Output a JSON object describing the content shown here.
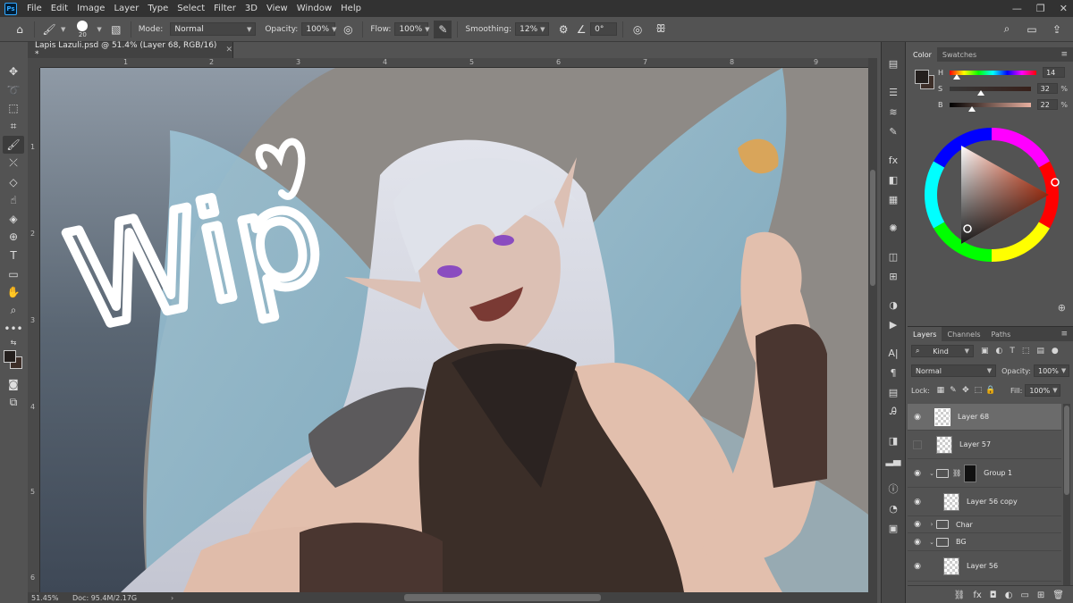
{
  "app": {
    "logo": "Ps"
  },
  "menu": [
    "File",
    "Edit",
    "Image",
    "Layer",
    "Type",
    "Select",
    "Filter",
    "3D",
    "View",
    "Window",
    "Help"
  ],
  "window_controls": {
    "minimize": "—",
    "restore": "❐",
    "close": "✕"
  },
  "options": {
    "brush_size": "20",
    "mode_label": "Mode:",
    "mode_value": "Normal",
    "opacity_label": "Opacity:",
    "opacity_value": "100%",
    "flow_label": "Flow:",
    "flow_value": "100%",
    "smoothing_label": "Smoothing:",
    "smoothing_value": "12%",
    "angle_value": "0°"
  },
  "document": {
    "tab_title": "Lapis Lazuli.psd @ 51.4% (Layer 68, RGB/16) *",
    "zoom": "51.45%",
    "doc_size": "Doc: 95.4M/2.17G",
    "canvas_text": "Wip"
  },
  "rulers": {
    "top": [
      "1",
      "2",
      "3",
      "4",
      "5",
      "6",
      "7",
      "8",
      "9"
    ],
    "left": [
      "1",
      "2",
      "3",
      "4",
      "5",
      "6"
    ]
  },
  "color_panel": {
    "tabs": [
      "Color",
      "Swatches"
    ],
    "h": {
      "label": "H",
      "value": "14",
      "unit": "",
      "fraction": 0.04
    },
    "s": {
      "label": "S",
      "value": "32",
      "unit": "%",
      "fraction": 0.32
    },
    "b": {
      "label": "B",
      "value": "22",
      "unit": "%",
      "fraction": 0.22
    },
    "foreground": "#241f1d",
    "background": "#3d2e28"
  },
  "layers_panel": {
    "tabs": [
      "Layers",
      "Channels",
      "Paths"
    ],
    "filter_kind": "Kind",
    "blend_mode": "Normal",
    "opacity_label": "Opacity:",
    "opacity_value": "100%",
    "lock_label": "Lock:",
    "fill_label": "Fill:",
    "fill_value": "100%",
    "layers": [
      {
        "name": "Layer 68",
        "visible": true,
        "selected": true,
        "kind": "pixel"
      },
      {
        "name": "Layer 57",
        "visible": false,
        "selected": false,
        "kind": "pixel"
      },
      {
        "name": "Group 1",
        "visible": true,
        "selected": false,
        "kind": "group-masked"
      },
      {
        "name": "Layer 56 copy",
        "visible": true,
        "selected": false,
        "kind": "pixel-indent"
      },
      {
        "name": "Char",
        "visible": true,
        "selected": false,
        "kind": "group-collapsed"
      },
      {
        "name": "BG",
        "visible": true,
        "selected": false,
        "kind": "group"
      },
      {
        "name": "Layer 56",
        "visible": true,
        "selected": false,
        "kind": "pixel-indent"
      }
    ]
  },
  "accent_colors": {
    "app_bg": "#535353",
    "menu_bg": "#323232",
    "selection": "#6b6b6b"
  }
}
